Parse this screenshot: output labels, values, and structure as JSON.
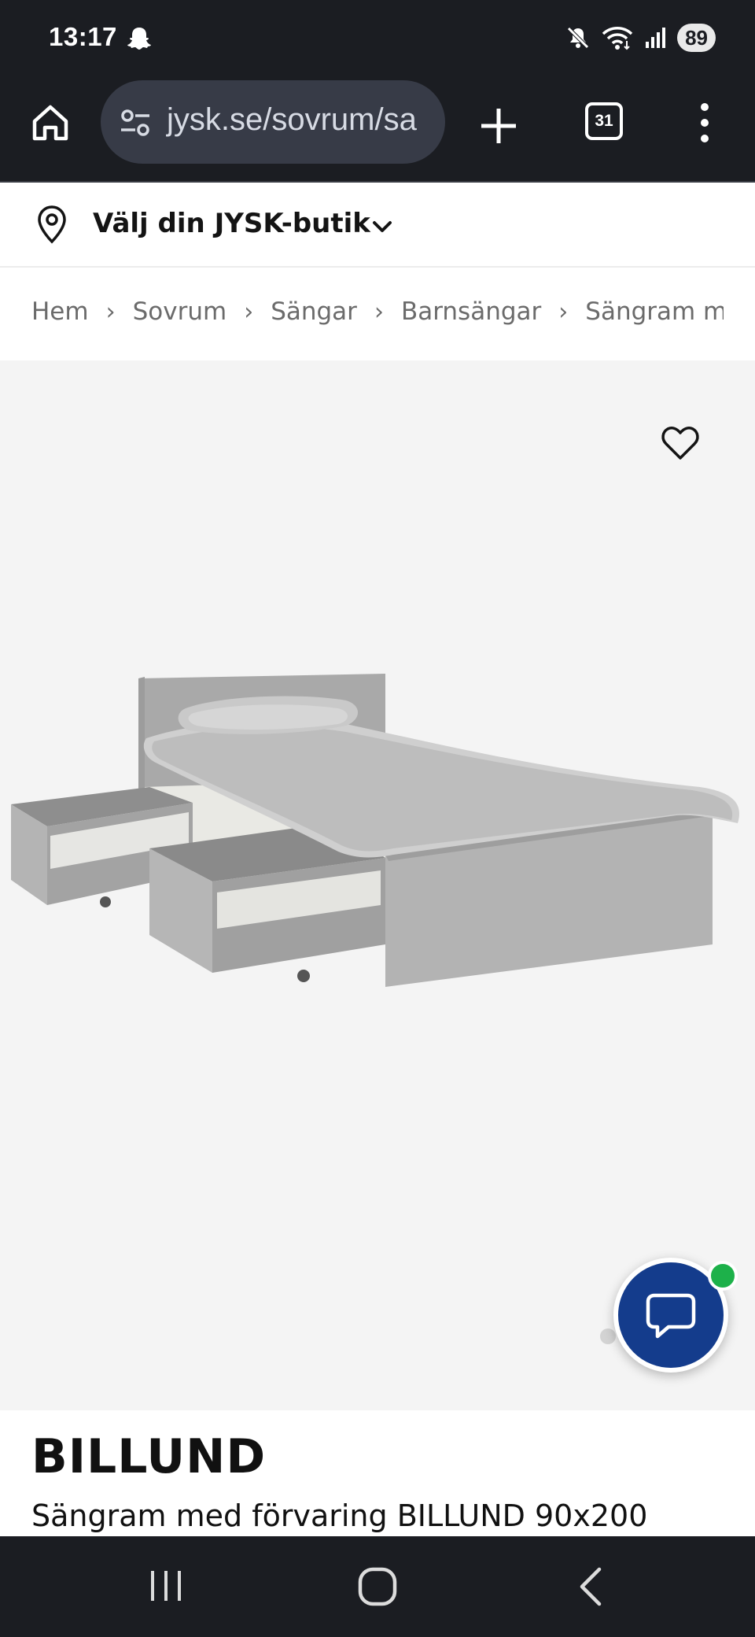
{
  "status_bar": {
    "time": "13:17",
    "battery": "89",
    "icons": [
      "snapchat-ghost-icon",
      "mute-icon",
      "wifi-icon",
      "signal-icon",
      "battery-icon"
    ]
  },
  "browser": {
    "url": "jysk.se/sovrum/sa",
    "tab_count": "31",
    "icons": [
      "home-icon",
      "site-settings-icon",
      "new-tab-icon",
      "tabs-icon",
      "more-icon"
    ]
  },
  "store_selector": {
    "label": "Välj din JYSK-butik",
    "icons": [
      "location-pin-icon",
      "chevron-down-icon"
    ]
  },
  "breadcrumb": {
    "items": [
      "Hem",
      "Sovrum",
      "Sängar",
      "Barnsängar",
      "Sängram me"
    ],
    "separator": "›"
  },
  "gallery": {
    "image": "bed-with-drawers",
    "icons": [
      "heart-icon",
      "chat-icon"
    ],
    "colors": {
      "background": "#f4f4f4",
      "chat": "#143c8c",
      "online": "#1db14a"
    }
  },
  "product": {
    "name": "BILLUND",
    "description": "Sängram med förvaring BILLUND 90x200"
  },
  "nav_bar": {
    "icons": [
      "recent-apps-icon",
      "home-button-icon",
      "back-icon"
    ]
  }
}
